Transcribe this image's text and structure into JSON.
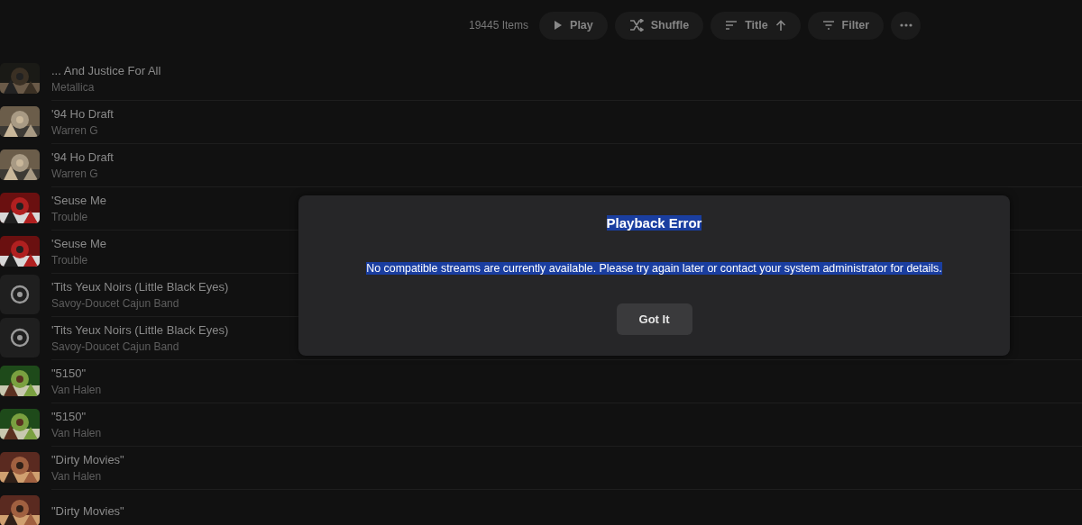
{
  "toolbar": {
    "count": "19445 Items",
    "buttons": [
      {
        "kind": "play",
        "label": "Play"
      },
      {
        "kind": "shuffle",
        "label": "Shuffle"
      },
      {
        "kind": "sort",
        "label": "Title",
        "ascending": true
      },
      {
        "kind": "filter",
        "label": "Filter"
      },
      {
        "kind": "more"
      }
    ]
  },
  "tracks": [
    {
      "title": "... And Justice For All",
      "artist": "Metallica",
      "has_artwork": true
    },
    {
      "title": "'94 Ho Draft",
      "artist": "Warren G",
      "has_artwork": true
    },
    {
      "title": "'94 Ho Draft",
      "artist": "Warren G",
      "has_artwork": true
    },
    {
      "title": "'Seuse Me",
      "artist": "Trouble",
      "has_artwork": true
    },
    {
      "title": "'Seuse Me",
      "artist": "Trouble",
      "has_artwork": true
    },
    {
      "title": "'Tits Yeux Noirs (Little Black Eyes)",
      "artist": "Savoy-Doucet Cajun Band",
      "has_artwork": false
    },
    {
      "title": "'Tits Yeux Noirs (Little Black Eyes)",
      "artist": "Savoy-Doucet Cajun Band",
      "has_artwork": false
    },
    {
      "title": "\"5150\"",
      "artist": "Van Halen",
      "has_artwork": true
    },
    {
      "title": "\"5150\"",
      "artist": "Van Halen",
      "has_artwork": true
    },
    {
      "title": "\"Dirty Movies\"",
      "artist": "Van Halen",
      "has_artwork": true
    },
    {
      "title": "\"Dirty Movies\"",
      "has_artwork": true
    }
  ],
  "dialog": {
    "title": "Playback Error",
    "message": "No compatible streams are currently available. Please try again later or contact your system administrator for details.",
    "text_selected": true,
    "button": "Got It"
  }
}
